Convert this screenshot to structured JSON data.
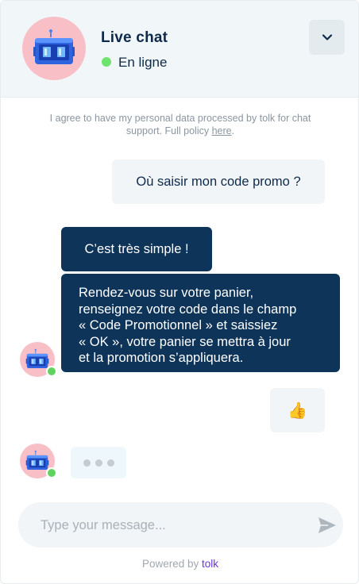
{
  "header": {
    "title": "Live chat",
    "status": "En ligne",
    "collapse_icon": "chevron-down-icon",
    "avatar_icon": "robot-icon"
  },
  "consent": {
    "text": "I agree to have my personal data processed by tolk for chat support. Full policy ",
    "link": "here",
    "suffix": "."
  },
  "messages": [
    {
      "from": "user",
      "text": "Où saisir mon code promo ?"
    },
    {
      "from": "bot",
      "text": "C’est très simple !"
    },
    {
      "from": "bot",
      "text": "Rendez-vous sur votre panier,\nrenseignez votre code dans le champ\n« Code Promotionnel » et saissiez\n« OK », votre panier se mettra à jour\net la promotion s’appliquera."
    },
    {
      "from": "user",
      "text": "👍"
    }
  ],
  "composer": {
    "placeholder": "Type your message...",
    "send_icon": "send-icon"
  },
  "footer": {
    "powered_by": "Powered by",
    "brand": "tolk"
  },
  "colors": {
    "bot_bubble": "#0e3459",
    "user_bubble": "#f2f5f7",
    "header_bg": "#f1f6f8",
    "online": "#6ee36e",
    "avatar_bg": "#f9bfc6",
    "brand": "#6b35e0"
  }
}
